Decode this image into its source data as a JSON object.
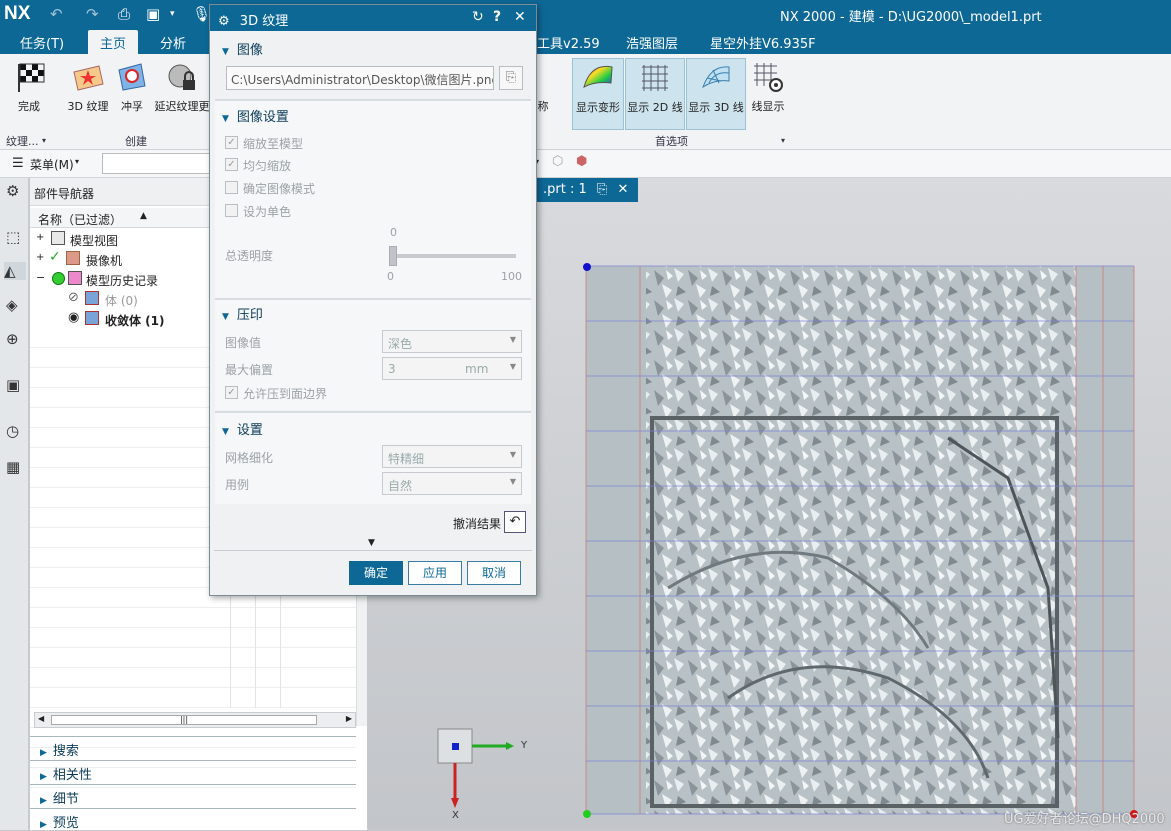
{
  "app": {
    "logo": "NX",
    "window_title": "NX 2000 - 建模 - D:\\UG2000\\_model1.prt"
  },
  "menu_tabs": [
    "任务(T)",
    "主页",
    "分析",
    "工具v2.59",
    "浩强图层",
    "星空外挂V6.935F"
  ],
  "ribbon": {
    "buttons": [
      "完成",
      "3D 纹理",
      "冲孚",
      "延迟纹理更",
      "称",
      "显示变形",
      "显示 2D 线",
      "显示 3D 线",
      "线显示"
    ],
    "groups": [
      "纹理...",
      "创建",
      "首选项"
    ]
  },
  "cmdbar": {
    "menu_label": "菜单(M)"
  },
  "navigator": {
    "title": "部件导航器",
    "column_header": "名称（已过滤）",
    "rows": [
      "模型视图",
      "摄像机",
      "模型历史记录",
      "体 (0)",
      "收敛体 (1)"
    ],
    "sections": [
      "搜索",
      "相关性",
      "细节",
      "预览"
    ]
  },
  "viewport": {
    "tab_label": ".prt : 1",
    "axis_y": "Y",
    "axis_x": "X"
  },
  "dialog": {
    "title": "3D 纹理",
    "sec_image": "图像",
    "image_path": "C:\\Users\\Administrator\\Desktop\\微信图片.png",
    "sec_image_settings": "图像设置",
    "chk_scale_model": "缩放至模型",
    "chk_uniform_scale": "均匀缩放",
    "chk_confirm_mode": "确定图像模式",
    "chk_monochrome": "设为单色",
    "transparency_label": "总透明度",
    "slider_value": "0",
    "slider_min": "0",
    "slider_max": "100",
    "sec_emboss": "压印",
    "image_value_label": "图像值",
    "image_value": "深色",
    "max_offset_label": "最大偏置",
    "max_offset_value": "3",
    "max_offset_unit": "mm",
    "chk_allow_boundary": "允许压到面边界",
    "sec_settings": "设置",
    "mesh_label": "网格细化",
    "mesh_value": "特精细",
    "use_case_label": "用例",
    "use_case_value": "自然",
    "undo_label": "撤消结果",
    "btn_ok": "确定",
    "btn_apply": "应用",
    "btn_cancel": "取消"
  },
  "watermark": "UG爱好者论坛@DHQ2000"
}
